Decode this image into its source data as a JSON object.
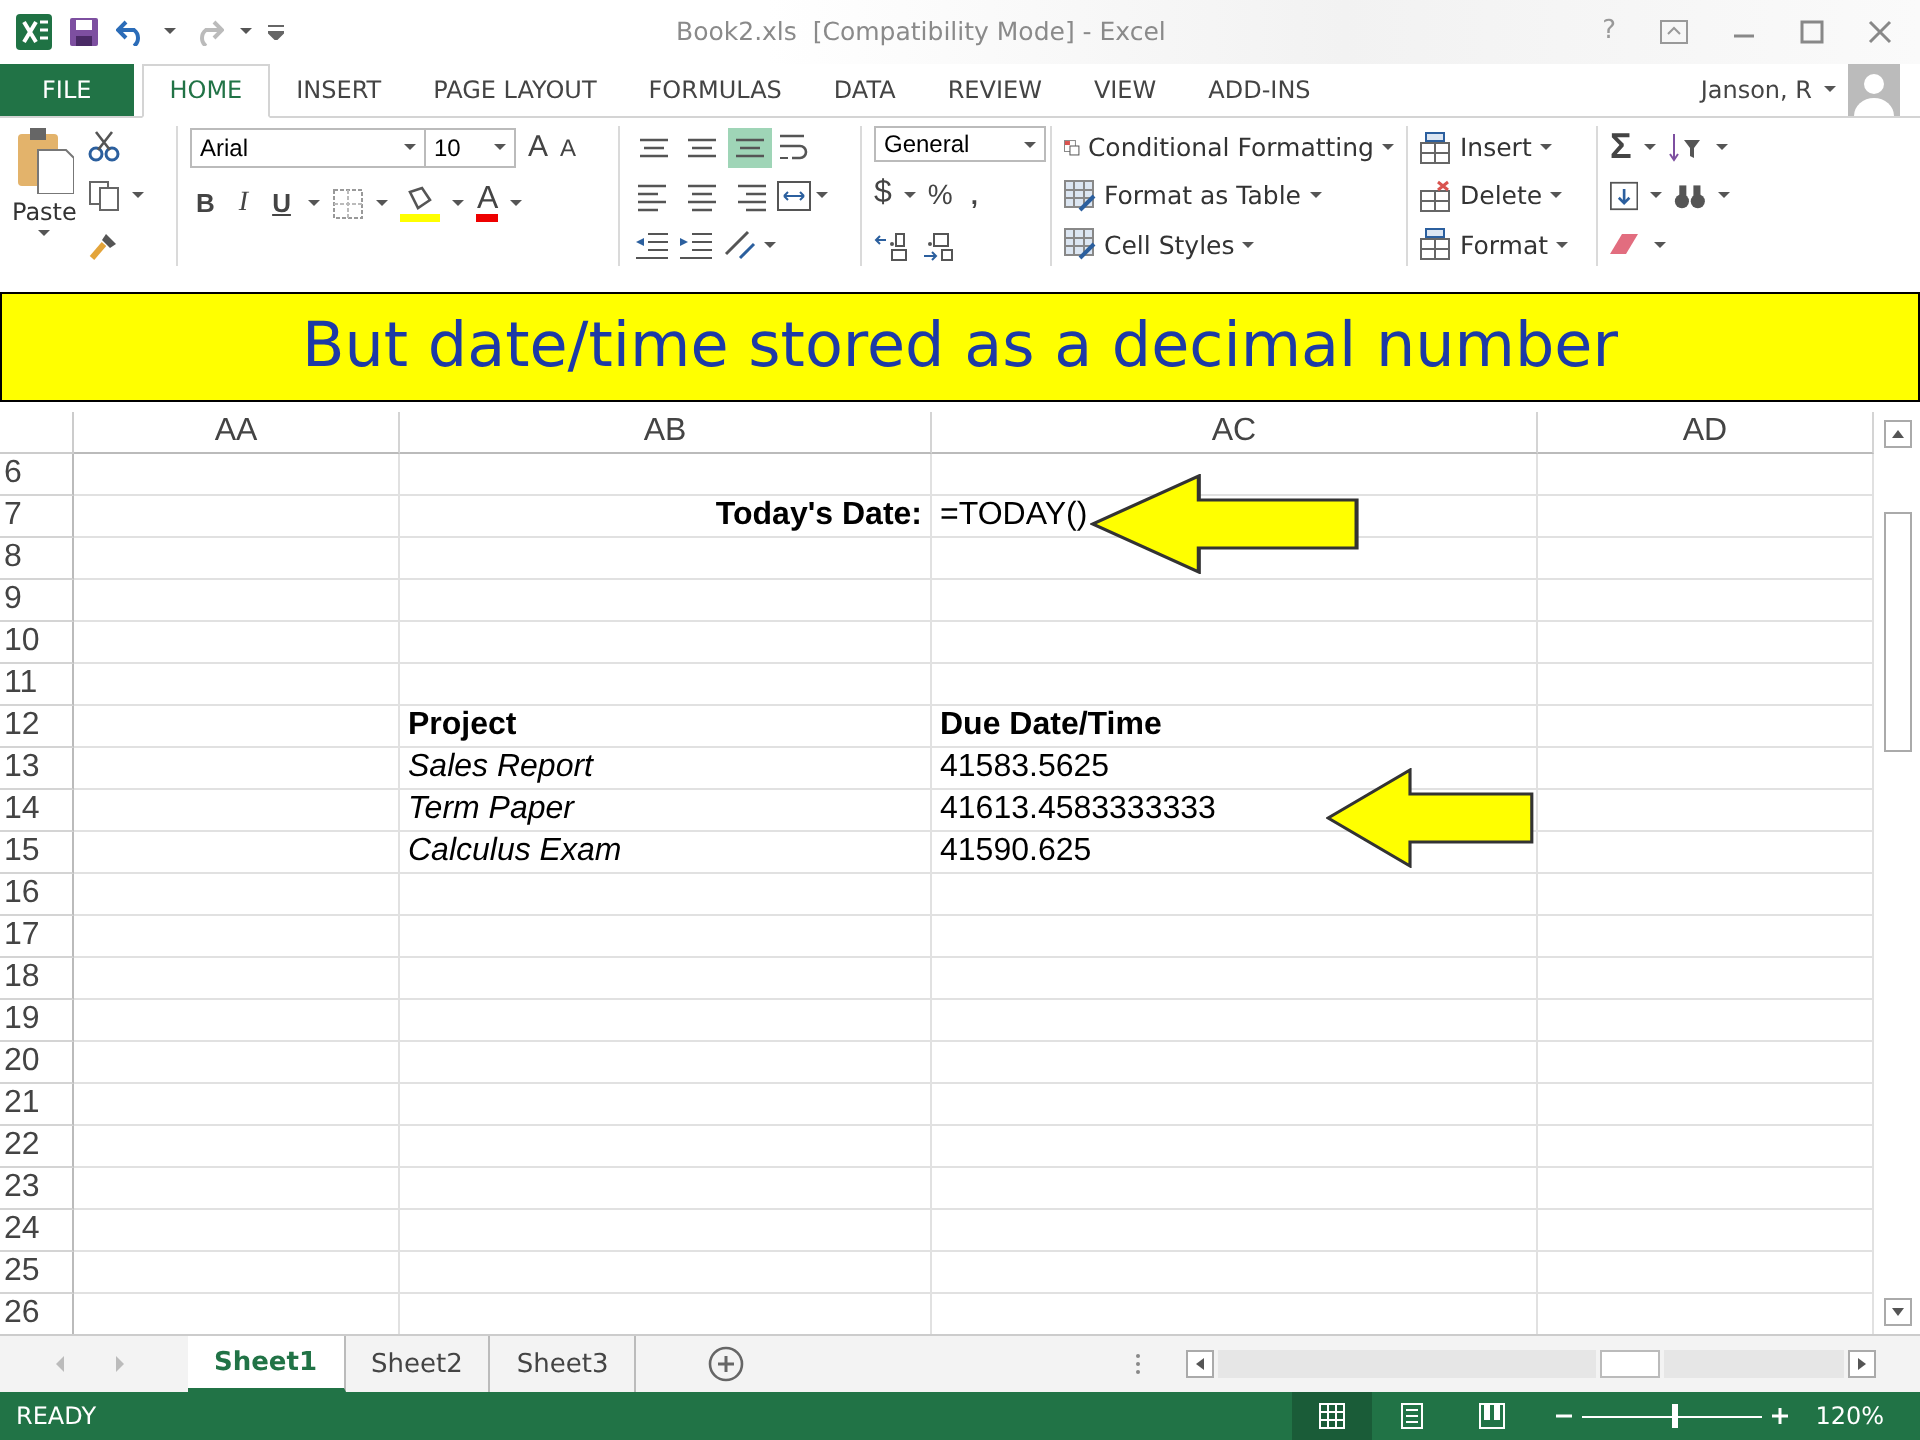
{
  "window": {
    "title": "Book2.xls  [Compatibility Mode] - Excel",
    "help": "?"
  },
  "tabs": [
    {
      "label": "FILE",
      "kind": "file",
      "selected": false
    },
    {
      "label": "HOME",
      "kind": "tab",
      "selected": true
    },
    {
      "label": "INSERT",
      "kind": "tab",
      "selected": false
    },
    {
      "label": "PAGE LAYOUT",
      "kind": "tab",
      "selected": false
    },
    {
      "label": "FORMULAS",
      "kind": "tab",
      "selected": false
    },
    {
      "label": "DATA",
      "kind": "tab",
      "selected": false
    },
    {
      "label": "REVIEW",
      "kind": "tab",
      "selected": false
    },
    {
      "label": "VIEW",
      "kind": "tab",
      "selected": false
    },
    {
      "label": "ADD-INS",
      "kind": "tab",
      "selected": false
    }
  ],
  "account": {
    "name": "Janson, R"
  },
  "ribbon": {
    "paste": "Paste",
    "font": {
      "name": "Arial",
      "size": "10",
      "grow": "A",
      "shrink": "A",
      "bold": "B",
      "italic": "I",
      "underline": "U",
      "color_letter": "A"
    },
    "number": {
      "format": "General",
      "currency": "$",
      "percent": "%",
      "comma": ","
    },
    "styles": [
      "Conditional Formatting",
      "Format as Table",
      "Cell Styles"
    ],
    "cells": [
      "Insert",
      "Delete",
      "Format"
    ],
    "editing": {
      "sum": "Σ"
    }
  },
  "banner": {
    "text": "But date/time stored as a decimal number"
  },
  "sheet": {
    "columns": [
      "AA",
      "AB",
      "AC",
      "AD"
    ],
    "rows": [
      {
        "number": "6"
      },
      {
        "number": "7",
        "kind": "label",
        "ab": "Today's Date:",
        "ac": "=TODAY()"
      },
      {
        "number": "8"
      },
      {
        "number": "9"
      },
      {
        "number": "10"
      },
      {
        "number": "11"
      },
      {
        "number": "12",
        "kind": "header",
        "ab": "Project",
        "ac": "Due Date/Time"
      },
      {
        "number": "13",
        "kind": "item",
        "ab": "Sales Report",
        "ac": "41583.5625"
      },
      {
        "number": "14",
        "kind": "item",
        "ab": "Term Paper",
        "ac": "41613.4583333333"
      },
      {
        "number": "15",
        "kind": "item",
        "ab": "Calculus Exam",
        "ac": "41590.625"
      },
      {
        "number": "16"
      },
      {
        "number": "17"
      },
      {
        "number": "18"
      },
      {
        "number": "19"
      },
      {
        "number": "20"
      },
      {
        "number": "21"
      },
      {
        "number": "22"
      },
      {
        "number": "23"
      },
      {
        "number": "24"
      },
      {
        "number": "25"
      },
      {
        "number": "26"
      }
    ]
  },
  "sheet_tabs": [
    {
      "label": "Sheet1",
      "selected": true
    },
    {
      "label": "Sheet2",
      "selected": false
    },
    {
      "label": "Sheet3",
      "selected": false
    }
  ],
  "status_bar": {
    "mode": "READY",
    "views": [
      {
        "selected": true
      },
      {
        "selected": false
      },
      {
        "selected": false
      }
    ],
    "zoom": {
      "level": 0.52,
      "reading": "120%"
    }
  }
}
